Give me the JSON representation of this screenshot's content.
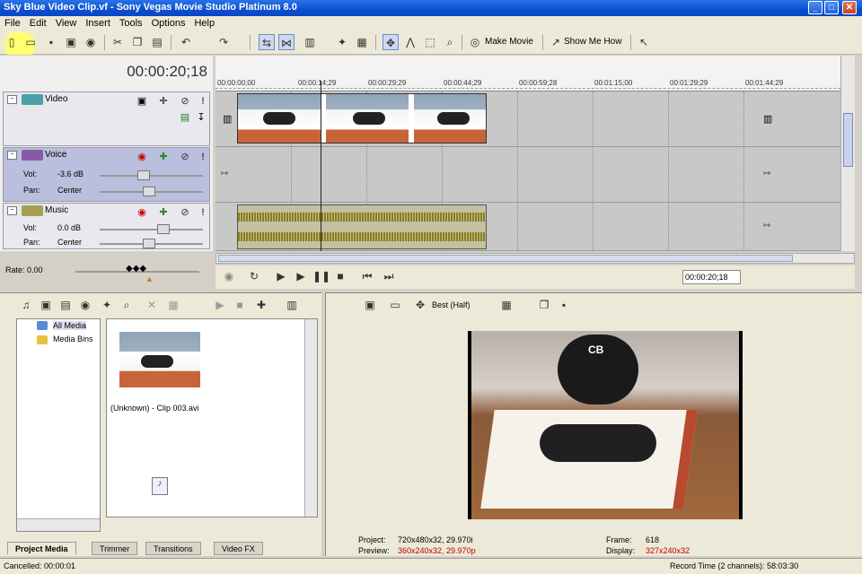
{
  "window": {
    "title": "Sky Blue Video Clip.vf - Sony Vegas Movie Studio Platinum 8.0",
    "min": "_",
    "max": "□",
    "close": "✕"
  },
  "menu": [
    "File",
    "Edit",
    "View",
    "Insert",
    "Tools",
    "Options",
    "Help"
  ],
  "toolbar": {
    "make_movie": "Make Movie",
    "show_me_how": "Show Me How"
  },
  "timecode": "00:00:20;18",
  "tracks": {
    "video": {
      "name": "Video"
    },
    "voice": {
      "name": "Voice",
      "vol_label": "Vol:",
      "vol_value": "-3.6 dB",
      "pan_label": "Pan:",
      "pan_value": "Center"
    },
    "music": {
      "name": "Music",
      "vol_label": "Vol:",
      "vol_value": "0.0 dB",
      "pan_label": "Pan:",
      "pan_value": "Center"
    }
  },
  "ruler": [
    "00:00:00;00",
    "00:00:14;29",
    "00:00:29;29",
    "00:00:44;29",
    "00:00:59;28",
    "00:01:15;00",
    "00:01:29;29",
    "00:01:44;29"
  ],
  "rate": "Rate: 0.00",
  "transport": {
    "timecode": "00:00:20;18"
  },
  "media": {
    "tree": [
      "All Media",
      "Media Bins"
    ],
    "clip_label": "(Unknown) - Clip 003.avi",
    "tabs": [
      "Project Media",
      "Trimmer",
      "Transitions",
      "Video FX"
    ]
  },
  "preview": {
    "quality": "Best (Half)",
    "project_label": "Project:",
    "project_value": "720x480x32, 29.970i",
    "preview_label": "Preview:",
    "preview_value": "360x240x32, 29.970p",
    "frame_label": "Frame:",
    "frame_value": "618",
    "display_label": "Display:",
    "display_value": "327x240x32",
    "drum_text": "CB"
  },
  "status": {
    "left": "Cancelled: 00:00:01",
    "right": "Record Time (2 channels): 58:03:30"
  },
  "colors": {
    "title_blue": "#0a4fd1",
    "voice_track": "#b9bfdc",
    "wave": "#8b7d1a",
    "chip_video": "#4aa0a8",
    "chip_voice": "#8a5aa8",
    "chip_music": "#a8a050",
    "red_text": "#c00000"
  }
}
